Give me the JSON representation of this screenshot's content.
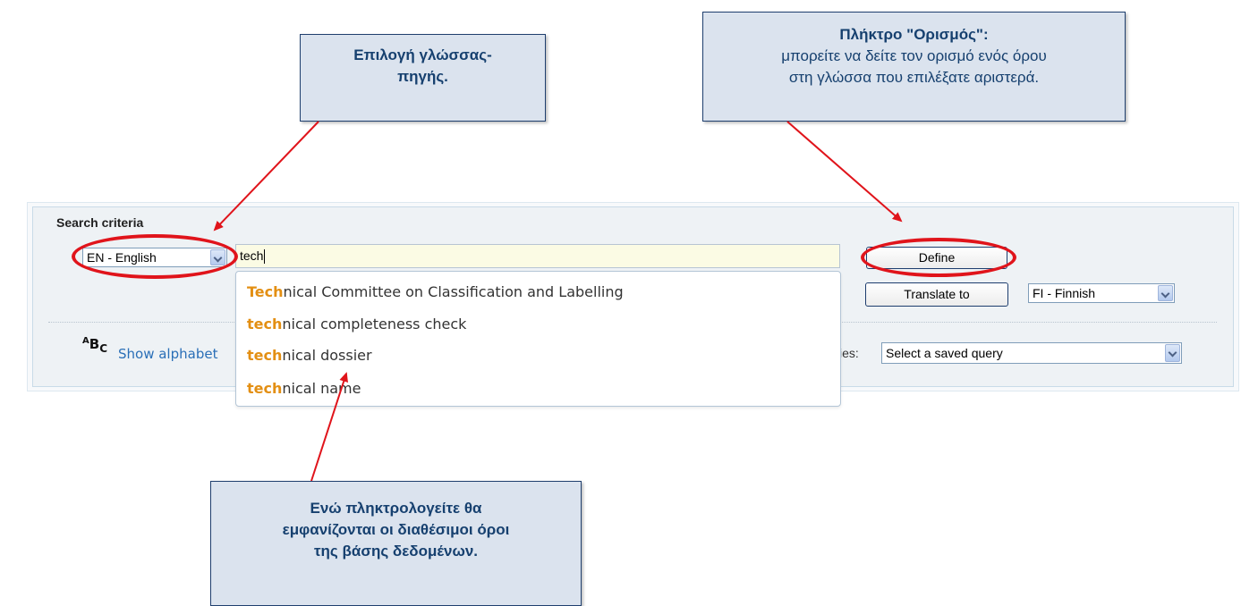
{
  "callouts": {
    "source_language": {
      "line1": "Επιλογή γλώσσας-",
      "line2": "πηγής."
    },
    "define": {
      "title": "Πλήκτρο \"Ορισμός\":",
      "line1": "μπορείτε να δείτε τον ορισμό ενός όρου",
      "line2": "στη γλώσσα που επιλέξατε αριστερά."
    },
    "suggestions": {
      "line1": "Ενώ πληκτρολογείτε θα",
      "line2": "εμφανίζονται οι διαθέσιμοι όροι",
      "line3": "της βάσης δεδομένων."
    }
  },
  "search": {
    "section_title": "Search criteria",
    "source_language": "EN - English",
    "term_value": "tech",
    "define_label": "Define",
    "translate_label": "Translate to",
    "target_language": "FI - Finnish",
    "alphabet_icon": "abc-icon",
    "alphabet_link": "Show alphabet",
    "saved_queries_label": "ies:",
    "saved_query_value": "Select a saved query"
  },
  "suggestions": [
    {
      "match": "Tech",
      "rest": "nical Committee on Classification and Labelling"
    },
    {
      "match": "tech",
      "rest": "nical completeness check"
    },
    {
      "match": "tech",
      "rest": "nical dossier"
    },
    {
      "match": "tech",
      "rest": "nical name"
    }
  ],
  "colors": {
    "highlight": "#e0141b",
    "callout_bg": "#dbe3ee",
    "callout_text": "#16406f",
    "match_text": "#e38f13",
    "link": "#2a6fb7"
  }
}
